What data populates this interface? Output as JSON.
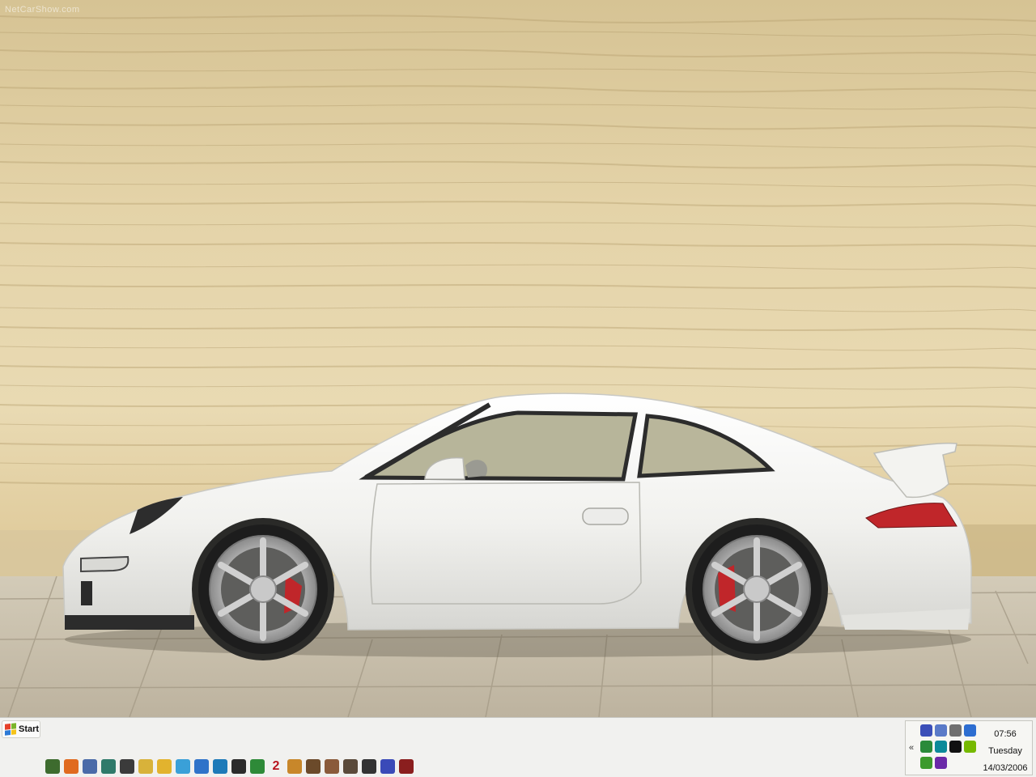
{
  "desktop": {
    "wallpaper": "white sports car wallpaper",
    "watermark": "NetCarShow.com"
  },
  "taskbar": {
    "start_label": "Start",
    "quick_launch": [
      {
        "icon": "arrow-cursor-icon",
        "color": "#3d6b2e"
      },
      {
        "icon": "people-icon",
        "color": "#e06a1f"
      },
      {
        "icon": "headphones-icon",
        "color": "#4a6aa8"
      },
      {
        "icon": "document-icon",
        "color": "#2f7a6a"
      },
      {
        "icon": "disc-icon",
        "color": "#3b3b3b"
      },
      {
        "icon": "camera-icon",
        "color": "#d8b23a"
      },
      {
        "icon": "folder-icon",
        "color": "#e2b32e"
      },
      {
        "icon": "refresh-icon",
        "color": "#3aa0d8"
      },
      {
        "icon": "globe-icon",
        "color": "#2f73c9"
      },
      {
        "icon": "image-icon",
        "color": "#1d7ab8"
      },
      {
        "icon": "game-icon",
        "color": "#2b2b2b"
      },
      {
        "icon": "grid-icon",
        "color": "#2e8a38"
      },
      {
        "icon": "number-icon",
        "color": "#b8141e",
        "label": "2"
      },
      {
        "icon": "smiley-icon",
        "color": "#c8872a"
      },
      {
        "icon": "figure-icon",
        "color": "#6b4a2a"
      },
      {
        "icon": "face-icon",
        "color": "#8a5a3a"
      },
      {
        "icon": "character-icon",
        "color": "#5a4a3a"
      },
      {
        "icon": "steam-icon",
        "color": "#333333"
      },
      {
        "icon": "football-icon",
        "color": "#3a4ab8"
      },
      {
        "icon": "puzzle-icon",
        "color": "#8a1e1e"
      }
    ],
    "tray": {
      "expand_label": "«",
      "icons": [
        {
          "icon": "network-icon",
          "color": "#3b4fb8"
        },
        {
          "icon": "network-error-icon",
          "color": "#5a7ac8"
        },
        {
          "icon": "disc-tray-icon",
          "color": "#707070"
        },
        {
          "icon": "volume-icon",
          "color": "#2d6ed1"
        },
        {
          "icon": "gamepad-icon",
          "color": "#2a8a3a"
        },
        {
          "icon": "messenger-icon",
          "color": "#0b8a9a"
        },
        {
          "icon": "winamp-icon",
          "color": "#111111"
        },
        {
          "icon": "nvidia-icon",
          "color": "#76b900"
        },
        {
          "icon": "windows-live-icon",
          "color": "#3c9a2c"
        },
        {
          "icon": "shield-icon",
          "color": "#6a2aa8"
        }
      ],
      "time": "07:56",
      "day": "Tuesday",
      "date": "14/03/2006"
    }
  },
  "colors": {
    "sky": "#e0cfa3",
    "ground": "#c8bea9",
    "car_body": "#f4f4f2",
    "taskbar": "#f1f1ef",
    "brake_caliper": "#c0262a"
  }
}
